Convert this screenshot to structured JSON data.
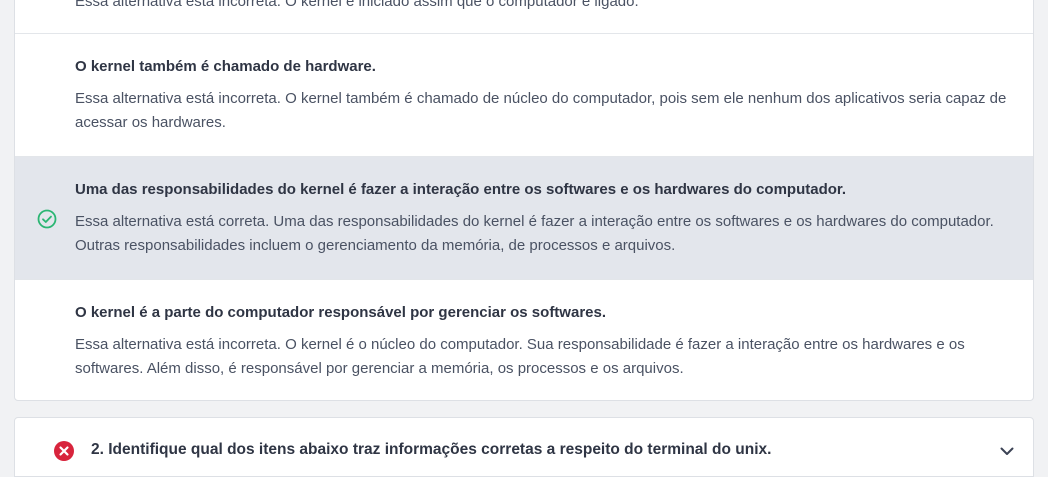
{
  "options": [
    {
      "title": "",
      "explanation": "Essa alternativa está incorreta. O kernel é iniciado assim que o computador é ligado.",
      "correct": false
    },
    {
      "title": "O kernel também é chamado de hardware.",
      "explanation": "Essa alternativa está incorreta. O kernel também é chamado de núcleo do computador, pois sem ele nenhum dos aplicativos seria capaz de acessar os hardwares.",
      "correct": false
    },
    {
      "title": "Uma das responsabilidades do kernel é fazer a interação entre os softwares e os hardwares do computador.",
      "explanation": "Essa alternativa está correta. Uma das responsabilidades do kernel é fazer a interação entre os softwares e os hardwares do computador. Outras responsabilidades incluem o gerenciamento da memória, de processos e arquivos.",
      "correct": true
    },
    {
      "title": "O kernel é a parte do computador responsável por gerenciar os softwares.",
      "explanation": "Essa alternativa está incorreta. O kernel é o núcleo do computador. Sua responsabilidade é fazer a interação entre os hardwares e os softwares. Além disso, é responsável por gerenciar a memória, os processos e os arquivos.",
      "correct": false
    }
  ],
  "question2": {
    "title": "2. Identifique qual dos itens abaixo traz informações corretas a respeito do terminal do unix.",
    "status_icon": "x-circle-icon",
    "expand_icon": "chevron-down-icon"
  },
  "icons": {
    "correct": "check-circle-icon"
  },
  "colors": {
    "correct_green": "#2bb673",
    "wrong_red": "#d8243c",
    "selected_bg": "#e3e6ec"
  }
}
